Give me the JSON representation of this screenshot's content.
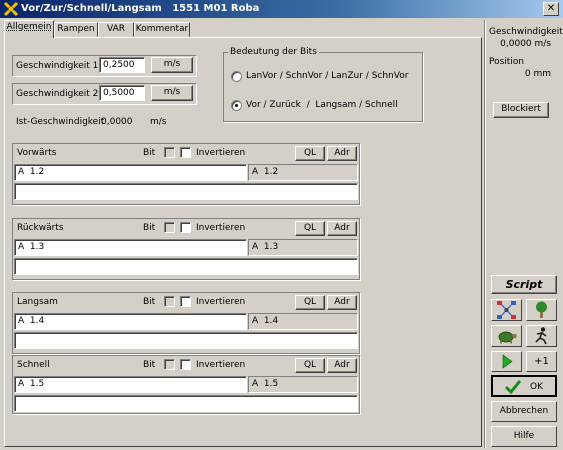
{
  "window": {
    "title": "Vor/Zur/Schnell/Langsam   1551 M01 Roba",
    "close_symbol": "✕"
  },
  "tabs": [
    {
      "label": "Allgemein",
      "active": true
    },
    {
      "label": "Rampen"
    },
    {
      "label": "VAR"
    },
    {
      "label": "Kommentar"
    }
  ],
  "speeds": {
    "speed1": {
      "label": "Geschwindigkeit 1",
      "value": "0,2500",
      "unit": "m/s"
    },
    "speed2": {
      "label": "Geschwindigkeit 2",
      "value": "0,5000",
      "unit": "m/s"
    },
    "actual": {
      "label": "Ist-Geschwindigkeit",
      "value": "0,0000",
      "unit": "m/s"
    }
  },
  "bits_meaning": {
    "title": "Bedeutung der Bits",
    "options": [
      {
        "label": "LanVor / SchnVor / LanZur / SchnVor",
        "selected": false
      },
      {
        "label": "Vor / Zurück  /  Langsam / Schnell",
        "selected": true
      }
    ]
  },
  "rows": [
    {
      "label": "Vorwärts",
      "bit_label": "Bit",
      "invert_label": "Invertieren",
      "ql_label": "QL",
      "adr_label": "Adr",
      "address": "A  1.2",
      "address_display": "A  1.2",
      "comment": ""
    },
    {
      "label": "Rückwärts",
      "bit_label": "Bit",
      "invert_label": "Invertieren",
      "ql_label": "QL",
      "adr_label": "Adr",
      "address": "A  1.3",
      "address_display": "A  1.3",
      "comment": ""
    },
    {
      "label": "Langsam",
      "bit_label": "Bit",
      "invert_label": "Invertieren",
      "ql_label": "QL",
      "adr_label": "Adr",
      "address": "A  1.4",
      "address_display": "A  1.4",
      "comment": ""
    },
    {
      "label": "Schnell",
      "bit_label": "Bit",
      "invert_label": "Invertieren",
      "ql_label": "QL",
      "adr_label": "Adr",
      "address": "A  1.5",
      "address_display": "A  1.5",
      "comment": ""
    }
  ],
  "sidebar": {
    "speed_label": "Geschwindigkeit",
    "speed_value": "0,0000 m/s",
    "position_label": "Position",
    "position_value": "0 mm",
    "blocked_button": "Blockiert",
    "script_button": "Script",
    "plus_one_button": "+1",
    "ok_button": "OK",
    "cancel_button": "Abbrechen",
    "help_button": "Hilfe"
  },
  "colors": {
    "title_bar": "#0a246a",
    "face": "#d4d0c8",
    "ok_check": "#1a8a1a",
    "play_green": "#22aa22"
  }
}
